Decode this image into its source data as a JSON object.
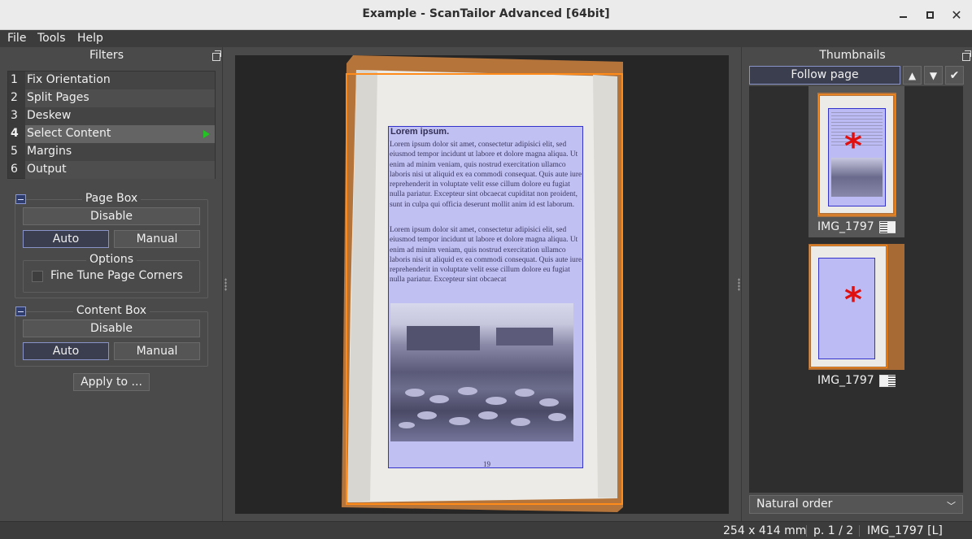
{
  "window": {
    "title": "Example - ScanTailor Advanced [64bit]"
  },
  "menu": [
    "File",
    "Tools",
    "Help"
  ],
  "filters": {
    "header": "Filters",
    "items": [
      {
        "num": "1",
        "label": "Fix Orientation"
      },
      {
        "num": "2",
        "label": "Split Pages"
      },
      {
        "num": "3",
        "label": "Deskew"
      },
      {
        "num": "4",
        "label": "Select Content"
      },
      {
        "num": "5",
        "label": "Margins"
      },
      {
        "num": "6",
        "label": "Output"
      }
    ],
    "selected_index": 3
  },
  "page_box": {
    "title": "Page Box",
    "disable": "Disable",
    "auto": "Auto",
    "manual": "Manual",
    "options_title": "Options",
    "fine_tune": "Fine Tune Page Corners"
  },
  "content_box": {
    "title": "Content Box",
    "disable": "Disable",
    "auto": "Auto",
    "manual": "Manual"
  },
  "apply_to": "Apply to ...",
  "page": {
    "heading": "Lorem ipsum.",
    "para1": "Lorem ipsum dolor sit amet, consectetur adipisici elit, sed eiusmod tempor incidunt ut labore et dolore magna aliqua. Ut enim ad minim veniam, quis nostrud exercitation ullamco laboris nisi ut aliquid ex ea commodi consequat. Quis aute iure reprehenderit in voluptate velit esse cillum dolore eu fugiat nulla pariatur. Excepteur sint obcaecat cupiditat non proident, sunt in culpa qui officia deserunt mollit anim id est laborum.",
    "para2": "Lorem ipsum dolor sit amet, consectetur adipisici elit, sed eiusmod tempor incidunt ut labore et dolore magna aliqua. Ut enim ad minim veniam, quis nostrud exercitation ullamco laboris nisi ut aliquid ex ea commodi consequat. Quis aute iure reprehenderit in voluptate velit esse cillum dolore eu fugiat nulla pariatur. Excepteur sint obcaecat",
    "page_number": "19"
  },
  "thumbnails": {
    "header": "Thumbnails",
    "follow_page": "Follow page",
    "items": [
      {
        "label": "IMG_1797",
        "icon": "left-page-icon"
      },
      {
        "label": "IMG_1797",
        "icon": "right-page-icon"
      }
    ],
    "sort_order": "Natural order"
  },
  "status": {
    "size": "254 x 414 mm",
    "page": "p. 1 / 2",
    "file": "IMG_1797 [L]"
  },
  "colors": {
    "page_box": "#ff8c1a",
    "content_box": "#3333cc",
    "content_fill": "#9999ff",
    "accent": "#8a93c8",
    "current_marker": "#24c324",
    "changed_marker": "#e01010"
  },
  "icons": [
    "minimize-icon",
    "maximize-icon",
    "close-icon",
    "float-panel-icon",
    "collapse-icon",
    "play-icon",
    "arrow-up-icon",
    "arrow-down-icon",
    "checkmark-icon",
    "asterisk-icon",
    "chevron-down-icon"
  ]
}
